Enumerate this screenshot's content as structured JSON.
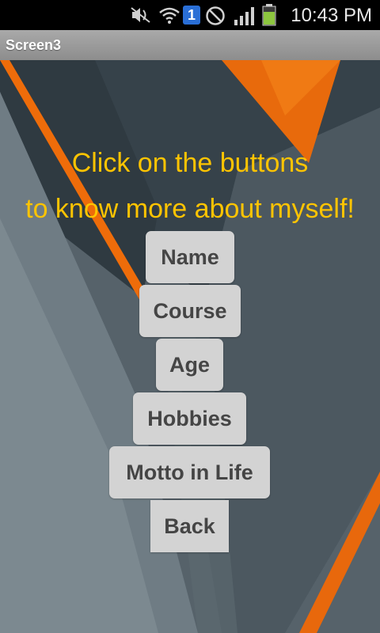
{
  "status_bar": {
    "time": "10:43 PM",
    "notification_badge": "1",
    "icons": [
      "muted-icon",
      "wifi-icon",
      "notification-badge-icon",
      "blocked-icon",
      "signal-icon",
      "battery-icon"
    ],
    "colors": {
      "badge": "#2a6fd6",
      "battery": "#8dc63f"
    }
  },
  "title_bar": {
    "title": "Screen3"
  },
  "main": {
    "heading_line1": "Click on the buttons",
    "heading_line2": "to know more about myself!",
    "heading_color": "#ffc400",
    "buttons": [
      {
        "label": "Name"
      },
      {
        "label": "Course"
      },
      {
        "label": "Age"
      },
      {
        "label": "Hobbies"
      },
      {
        "label": "Motto in Life"
      },
      {
        "label": "Back"
      }
    ],
    "accent_color": "#f06a0a"
  }
}
